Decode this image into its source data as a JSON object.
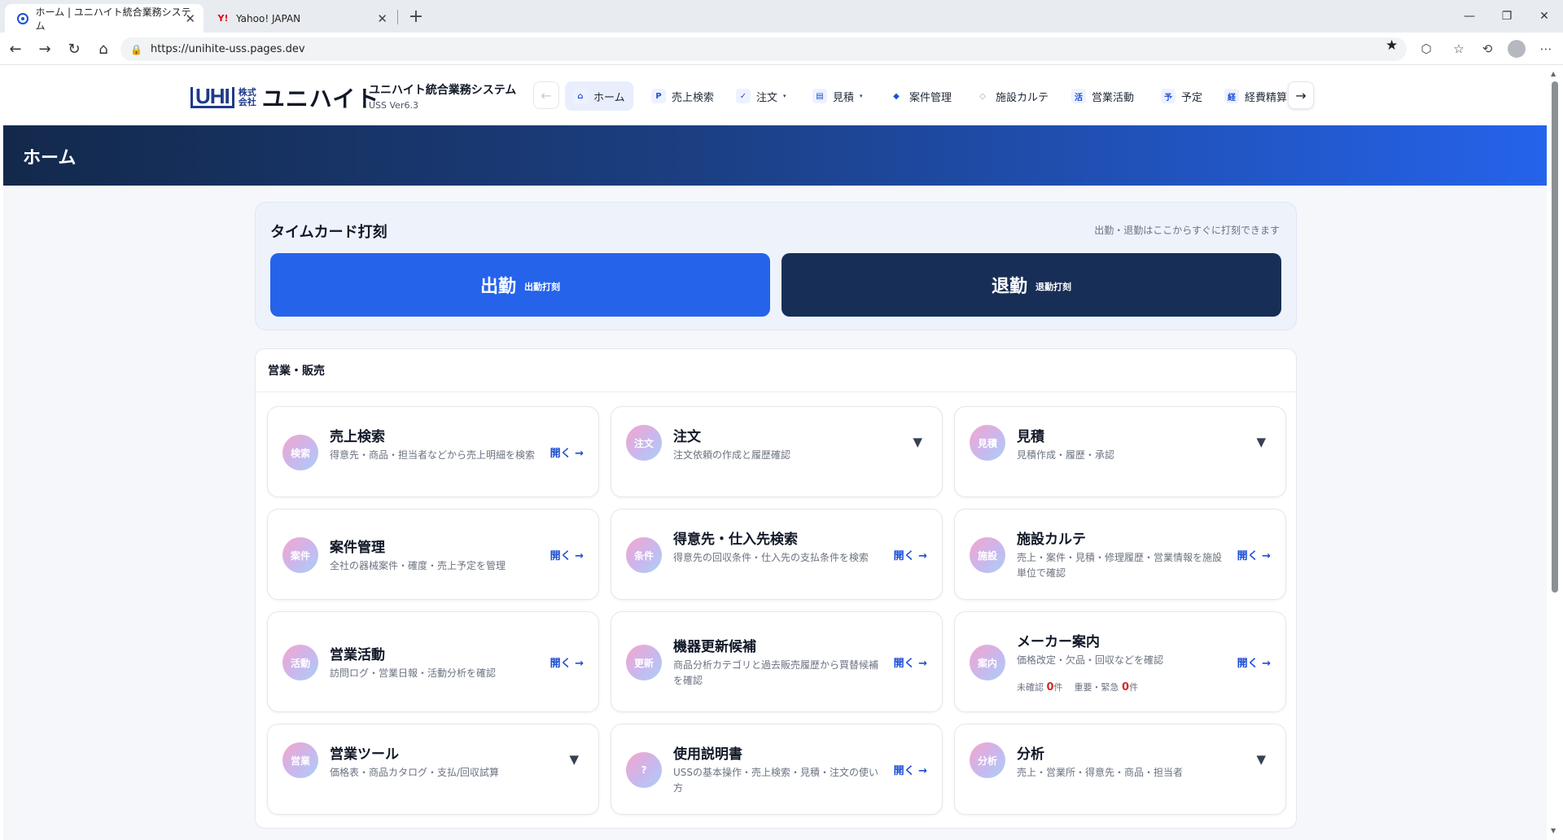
{
  "browser": {
    "tabs": [
      {
        "title": "ホーム | ユニハイト統合業務システム",
        "favicon": "uss-favicon-icon"
      },
      {
        "title": "Yahoo! JAPAN",
        "favicon": "yahoo-favicon-icon",
        "favicon_text": "Y!"
      }
    ],
    "url": "https://unihite-uss.pages.dev",
    "window_controls": {
      "minimize": "—",
      "restore": "❐",
      "close": "✕"
    }
  },
  "header": {
    "logo": {
      "mark": "UHI",
      "kabu": "株式会社",
      "name": "ユニハイト"
    },
    "system_name": "ユニハイト統合業務システム",
    "version": "USS Ver6.3",
    "nav_prev": "←",
    "nav_next": "→",
    "nav": [
      {
        "label": "ホーム",
        "icon": "⌂",
        "active": true
      },
      {
        "label": "売上検索",
        "icon": "P"
      },
      {
        "label": "注文",
        "icon": "✓",
        "dropdown": true
      },
      {
        "label": "見積",
        "icon": "▤",
        "dropdown": true
      },
      {
        "label": "案件管理",
        "icon": "◆"
      },
      {
        "label": "施設カルテ",
        "icon": "◇"
      },
      {
        "label": "営業活動",
        "icon": "活"
      },
      {
        "label": "予定",
        "icon": "予"
      },
      {
        "label": "経費精算",
        "icon": "経"
      }
    ],
    "caret": "▾"
  },
  "page": {
    "title": "ホーム"
  },
  "timecard": {
    "title": "タイムカード打刻",
    "hint": "出勤・退勤はここからすぐに打刻できます",
    "clock_in": {
      "label": "出勤",
      "sub": "出勤打刻"
    },
    "clock_out": {
      "label": "退勤",
      "sub": "退勤打刻"
    }
  },
  "sales_section": {
    "title": "営業・販売",
    "open_label": "開く →",
    "expand_label": "▼",
    "cards": [
      {
        "icon": "検索",
        "title": "売上検索",
        "desc": "得意先・商品・担当者などから売上明細を検索",
        "action": "open"
      },
      {
        "icon": "注文",
        "title": "注文",
        "desc": "注文依頼の作成と履歴確認",
        "action": "expand"
      },
      {
        "icon": "見積",
        "title": "見積",
        "desc": "見積作成・履歴・承認",
        "action": "expand"
      },
      {
        "icon": "案件",
        "title": "案件管理",
        "desc": "全社の器械案件・確度・売上予定を管理",
        "action": "open"
      },
      {
        "icon": "条件",
        "title": "得意先・仕入先検索",
        "desc": "得意先の回収条件・仕入先の支払条件を検索",
        "action": "open"
      },
      {
        "icon": "施設",
        "title": "施設カルテ",
        "desc": "売上・案件・見積・修理履歴・営業情報を施設単位で確認",
        "action": "open"
      },
      {
        "icon": "活動",
        "title": "営業活動",
        "desc": "訪問ログ・営業日報・活動分析を確認",
        "action": "open"
      },
      {
        "icon": "更新",
        "title": "機器更新候補",
        "desc": "商品分析カテゴリと過去販売履歴から買替候補を確認",
        "action": "open"
      },
      {
        "icon": "案内",
        "title": "メーカー案内",
        "desc": "価格改定・欠品・回収などを確認",
        "action": "open",
        "stats": {
          "unconfirmed_label": "未確認",
          "unconfirmed": "0",
          "important_label": "重要・緊急",
          "important": "0",
          "unit": "件"
        }
      },
      {
        "icon": "営業",
        "title": "営業ツール",
        "desc": "価格表・商品カタログ・支払/回収試算",
        "action": "expand"
      },
      {
        "icon": "?",
        "title": "使用説明書",
        "desc": "USSの基本操作・売上検索・見積・注文の使い方",
        "action": "open"
      },
      {
        "icon": "分析",
        "title": "分析",
        "desc": "売上・営業所・得意先・商品・担当者",
        "action": "expand"
      }
    ]
  },
  "colors": {
    "primary": "#2563eb",
    "navy": "#172f56",
    "accent_red": "#dc2626"
  }
}
